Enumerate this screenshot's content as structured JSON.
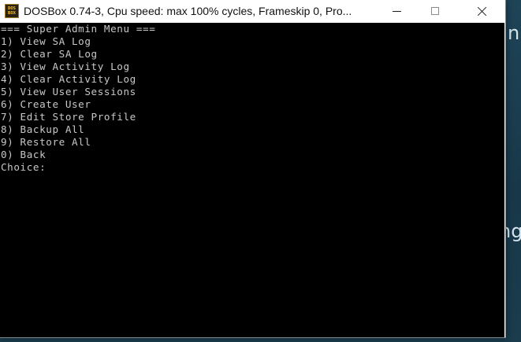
{
  "window": {
    "title": "DOSBox 0.74-3, Cpu speed: max 100% cycles, Frameskip  0, Pro...",
    "icon": "dosbox-icon",
    "icon_text_top": "DOS",
    "icon_text_bottom": "BOX",
    "controls": [
      "minimize-icon",
      "maximize-icon",
      "close-icon"
    ]
  },
  "background": {
    "glyph_top": "n",
    "glyph_mid": "ng"
  },
  "console": {
    "title_line": "=== Super Admin Menu ===",
    "menu_items": [
      "1) View SA Log",
      "2) Clear SA Log",
      "3) View Activity Log",
      "4) Clear Activity Log",
      "5) View User Sessions",
      "6) Create User",
      "7) Edit Store Profile",
      "8) Backup All",
      "9) Restore All",
      "0) Back"
    ],
    "prompt": "Choice:"
  },
  "colors": {
    "console_bg": "#000000",
    "console_text": "#c8c8c8",
    "titlebar_bg": "#ffffff",
    "desktop_bg": "#1b3f52"
  }
}
